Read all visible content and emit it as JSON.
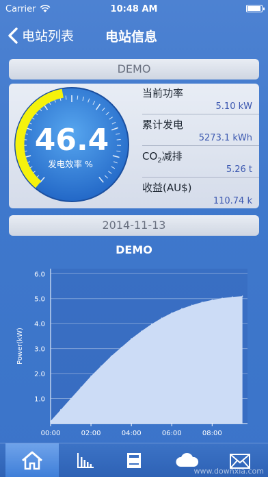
{
  "status_bar": {
    "carrier": "Carrier",
    "time": "10:48 AM",
    "battery_level": 0.95
  },
  "nav": {
    "back_label": "电站列表",
    "title": "电站信息"
  },
  "station": {
    "name": "DEMO"
  },
  "gauge": {
    "value": "46.4",
    "label": "发电效率 %",
    "percent": 46.4,
    "accent": "#f5f20c"
  },
  "metrics": [
    {
      "label": "当前功率",
      "value": "5.10 kW"
    },
    {
      "label": "累计发电",
      "value": "5273.1 kWh"
    },
    {
      "label_main": "CO",
      "label_sub": "2",
      "label_rest": "减排",
      "value": "5.26 t"
    },
    {
      "label": "收益(AU$)",
      "value": "110.74 k"
    }
  ],
  "date": "2014-11-13",
  "chart_data": {
    "type": "area",
    "title": "DEMO",
    "ylabel": "Power(kW)",
    "xlabel": "",
    "x_ticks": [
      "00:00",
      "02:00",
      "04:00",
      "06:00",
      "08:00"
    ],
    "y_ticks": [
      "1.0",
      "2.0",
      "3.0",
      "4.0",
      "5.0",
      "6.0"
    ],
    "xlim": [
      0,
      9.75
    ],
    "ylim": [
      0,
      6.2
    ],
    "x": [
      0,
      0.5,
      1,
      1.5,
      2,
      2.5,
      3,
      3.5,
      4,
      4.5,
      5,
      5.5,
      6,
      6.5,
      7,
      7.5,
      8,
      8.5,
      9,
      9.5
    ],
    "values": [
      0.1,
      0.55,
      1.0,
      1.45,
      1.9,
      2.3,
      2.7,
      3.05,
      3.4,
      3.7,
      3.98,
      4.22,
      4.43,
      4.6,
      4.74,
      4.86,
      4.95,
      5.02,
      5.07,
      5.1
    ],
    "fill": "#ccdcf6",
    "grid": true
  },
  "tabs": [
    {
      "name": "home",
      "icon": "home-icon"
    },
    {
      "name": "chart",
      "icon": "bar-chart-icon"
    },
    {
      "name": "device",
      "icon": "device-icon"
    },
    {
      "name": "weather",
      "icon": "cloud-icon"
    },
    {
      "name": "mail",
      "icon": "mail-icon"
    }
  ],
  "watermark": "www.downxia.com"
}
